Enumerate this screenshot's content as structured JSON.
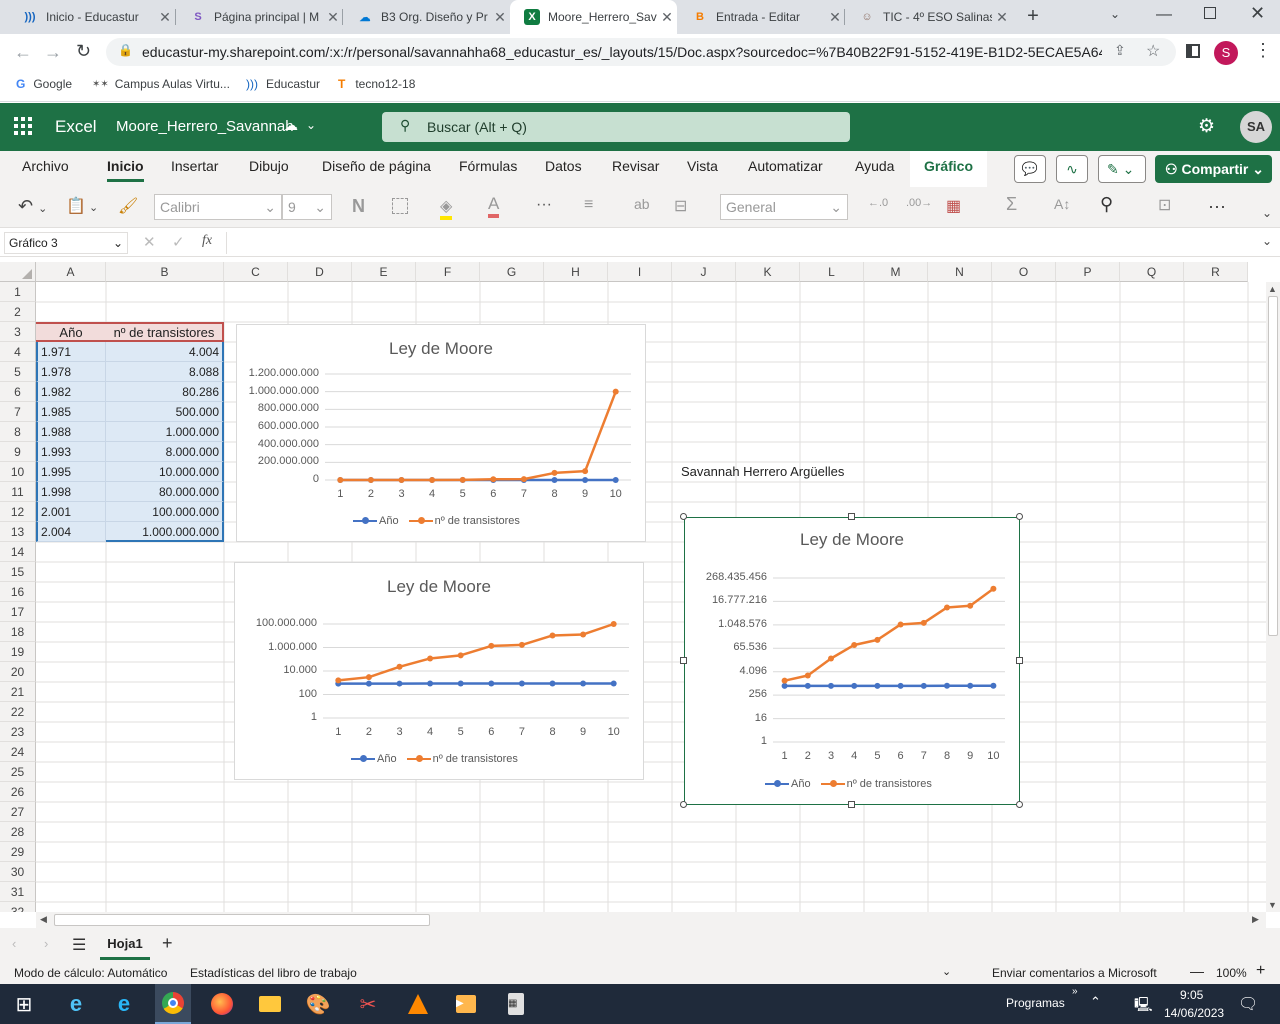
{
  "browser": {
    "tabs": [
      {
        "title": "Inicio - Educastur",
        "fav": ")))",
        "color": "#1565c0"
      },
      {
        "title": "Página principal | M",
        "fav": "S",
        "color": "#7e57c2"
      },
      {
        "title": "B3 Org. Diseño y Pr",
        "fav": "☁",
        "color": "#0078d4"
      },
      {
        "title": "Moore_Herrero_Sav",
        "fav": "X",
        "color": "#107c41"
      },
      {
        "title": "Entrada - Editar",
        "fav": "B",
        "color": "#f57c00"
      },
      {
        "title": "TIC - 4º ESO Salinas",
        "fav": "☺",
        "color": "#8d6e63"
      }
    ],
    "url": "educastur-my.sharepoint.com/:x:/r/personal/savannahha68_educastur_es/_layouts/15/Doc.aspx?sourcedoc=%7B40B22F91-5152-419E-B1D2-5ECAE5A641...",
    "bookmarks": [
      "Google",
      "Campus Aulas Virtu...",
      "Educastur",
      "tecno12-18"
    ],
    "profile_initial": "S"
  },
  "excel": {
    "app": "Excel",
    "filename": "Moore_Herrero_Savannah",
    "search_placeholder": "Buscar (Alt + Q)",
    "avatar": "SA",
    "menu": [
      "Archivo",
      "Inicio",
      "Insertar",
      "Dibujo",
      "Diseño de página",
      "Fórmulas",
      "Datos",
      "Revisar",
      "Vista",
      "Automatizar",
      "Ayuda",
      "Gráfico"
    ],
    "share_label": "Compartir",
    "font_name": "Calibri",
    "font_size": "9",
    "number_format": "General",
    "bold_label": "N",
    "name_box": "Gráfico 3",
    "fx_label": "fx",
    "columns": [
      "A",
      "B",
      "C",
      "D",
      "E",
      "F",
      "G",
      "H",
      "I",
      "J",
      "K",
      "L",
      "M",
      "N",
      "O",
      "P",
      "Q",
      "R"
    ],
    "rows": [
      "1",
      "2",
      "3",
      "4",
      "5",
      "6",
      "7",
      "8",
      "9",
      "10",
      "11",
      "12",
      "13",
      "14",
      "15",
      "16",
      "17",
      "18",
      "19",
      "20",
      "21",
      "22",
      "23",
      "24",
      "25",
      "26",
      "27",
      "28",
      "29",
      "30",
      "31",
      "32"
    ],
    "table_headers": [
      "Año",
      "nº de transistores"
    ],
    "table_rows": [
      [
        "1.971",
        "4.004"
      ],
      [
        "1.978",
        "8.088"
      ],
      [
        "1.982",
        "80.286"
      ],
      [
        "1.985",
        "500.000"
      ],
      [
        "1.988",
        "1.000.000"
      ],
      [
        "1.993",
        "8.000.000"
      ],
      [
        "1.995",
        "10.000.000"
      ],
      [
        "1.998",
        "80.000.000"
      ],
      [
        "2.001",
        "100.000.000"
      ],
      [
        "2.004",
        "1.000.000.000"
      ]
    ],
    "author": "Savannah Herrero Argüelles",
    "sheet_name": "Hoja1",
    "status_left": "Modo de cálculo: Automático",
    "status_mid": "Estadísticas del libro de trabajo",
    "status_feedback": "Enviar comentarios a Microsoft",
    "zoom": "100%"
  },
  "chart_data": [
    {
      "type": "line",
      "title": "Ley de Moore",
      "categories": [
        "1",
        "2",
        "3",
        "4",
        "5",
        "6",
        "7",
        "8",
        "9",
        "10"
      ],
      "y_ticks": [
        "1.200.000.000",
        "1.000.000.000",
        "800.000.000",
        "600.000.000",
        "400.000.000",
        "200.000.000",
        "0"
      ],
      "ylim": [
        0,
        1200000000
      ],
      "scale": "linear",
      "series": [
        {
          "name": "Año",
          "color": "#4472c4",
          "values": [
            1971,
            1978,
            1982,
            1985,
            1988,
            1993,
            1995,
            1998,
            2001,
            2004
          ]
        },
        {
          "name": "nº de transistores",
          "color": "#ed7d31",
          "values": [
            4004,
            8088,
            80286,
            500000,
            1000000,
            8000000,
            10000000,
            80000000,
            100000000,
            1000000000
          ]
        }
      ],
      "legend": "bottom"
    },
    {
      "type": "line",
      "title": "Ley de Moore",
      "categories": [
        "1",
        "2",
        "3",
        "4",
        "5",
        "6",
        "7",
        "8",
        "9",
        "10"
      ],
      "y_ticks": [
        "100.000.000",
        "1.000.000",
        "10.000",
        "100",
        "1"
      ],
      "ylim": [
        1,
        1000000000
      ],
      "scale": "log10",
      "series": [
        {
          "name": "Año",
          "color": "#4472c4",
          "values": [
            1971,
            1978,
            1982,
            1985,
            1988,
            1993,
            1995,
            1998,
            2001,
            2004
          ]
        },
        {
          "name": "nº de transistores",
          "color": "#ed7d31",
          "values": [
            4004,
            8088,
            80286,
            500000,
            1000000,
            8000000,
            10000000,
            80000000,
            100000000,
            1000000000
          ]
        }
      ],
      "legend": "bottom"
    },
    {
      "type": "line",
      "title": "Ley de Moore",
      "categories": [
        "1",
        "2",
        "3",
        "4",
        "5",
        "6",
        "7",
        "8",
        "9",
        "10"
      ],
      "y_ticks": [
        "268.435.456",
        "16.777.216",
        "1.048.576",
        "65.536",
        "4.096",
        "256",
        "16",
        "1"
      ],
      "ylim": [
        1,
        4294967296
      ],
      "scale": "log16",
      "series": [
        {
          "name": "Año",
          "color": "#4472c4",
          "values": [
            1971,
            1978,
            1982,
            1985,
            1988,
            1993,
            1995,
            1998,
            2001,
            2004
          ]
        },
        {
          "name": "nº de transistores",
          "color": "#ed7d31",
          "values": [
            4004,
            8088,
            80286,
            500000,
            1000000,
            8000000,
            10000000,
            80000000,
            100000000,
            1000000000
          ]
        }
      ],
      "legend": "bottom"
    }
  ],
  "taskbar": {
    "programs_label": "Programas",
    "time": "9:05",
    "date": "14/06/2023"
  }
}
